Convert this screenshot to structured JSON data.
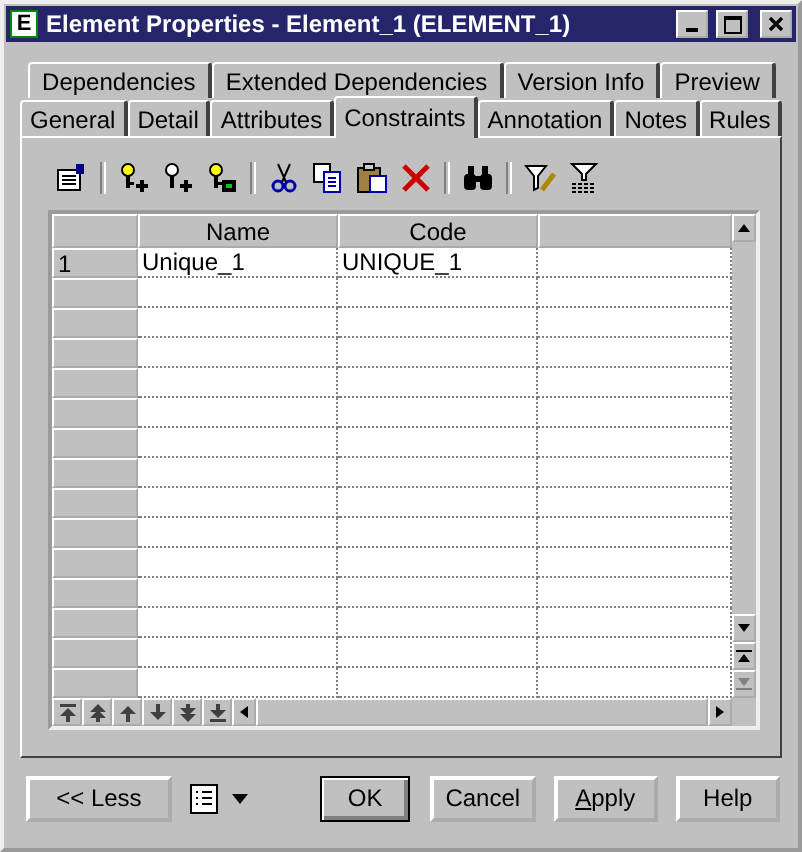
{
  "window": {
    "title": "Element Properties - Element_1 (ELEMENT_1)",
    "icon_letter": "E"
  },
  "tab_rows": [
    [
      {
        "label": "Dependencies",
        "selected": false
      },
      {
        "label": "Extended Dependencies",
        "selected": false
      },
      {
        "label": "Version Info",
        "selected": false
      },
      {
        "label": "Preview",
        "selected": false
      }
    ],
    [
      {
        "label": "General",
        "selected": false
      },
      {
        "label": "Detail",
        "selected": false
      },
      {
        "label": "Attributes",
        "selected": false
      },
      {
        "label": "Constraints",
        "selected": true
      },
      {
        "label": "Annotation",
        "selected": false
      },
      {
        "label": "Notes",
        "selected": false
      },
      {
        "label": "Rules",
        "selected": false
      }
    ]
  ],
  "table": {
    "columns": [
      "Name",
      "Code"
    ],
    "rows": [
      {
        "number": "1",
        "cells": [
          "Unique_1",
          "UNIQUE_1"
        ]
      }
    ]
  },
  "buttons": [
    {
      "label": "<< Less",
      "default": false,
      "access_key_underlined": false
    },
    {
      "label": "OK",
      "default": true,
      "access_key_underlined": false
    },
    {
      "label": "Cancel",
      "default": false,
      "access_key_underlined": false
    },
    {
      "label": "Apply",
      "default": false,
      "access_key_underlined": true
    },
    {
      "label": "Help",
      "default": false,
      "access_key_underlined": false
    }
  ]
}
